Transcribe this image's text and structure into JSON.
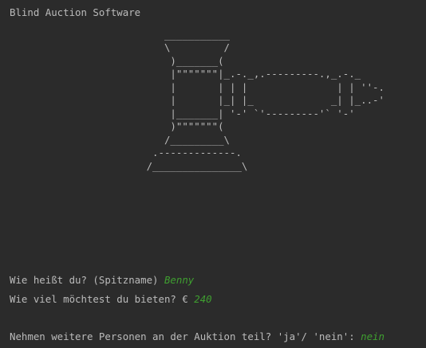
{
  "console": {
    "title": "Blind Auction Software",
    "ascii_art": "                          ___________\n                          \\         /\n                           )_______(\n                           |\"\"\"\"\"\"\"|_.-._,.---------.,_.-._\n                           |       | | |               | | ''-.\n                           |       |_| |_             _| |_..-'\n                           |_______| '-' `'---------'` '-'\n                           )\"\"\"\"\"\"\"(\n                          /_________\\\n                        .-------------.\n                       /_______________\\",
    "prompts": [
      {
        "question": "Wie heißt du? (Spitzname) ",
        "answer": "Benny"
      },
      {
        "question": "Wie viel möchtest du bieten? € ",
        "answer": "240"
      },
      {
        "question": "Nehmen weitere Personen an der Auktion teil? 'ja'/ 'nein': ",
        "answer": "nein"
      }
    ]
  },
  "colors": {
    "background": "#2b2b2b",
    "text": "#bbbbbb",
    "user_input": "#3f9f30"
  }
}
